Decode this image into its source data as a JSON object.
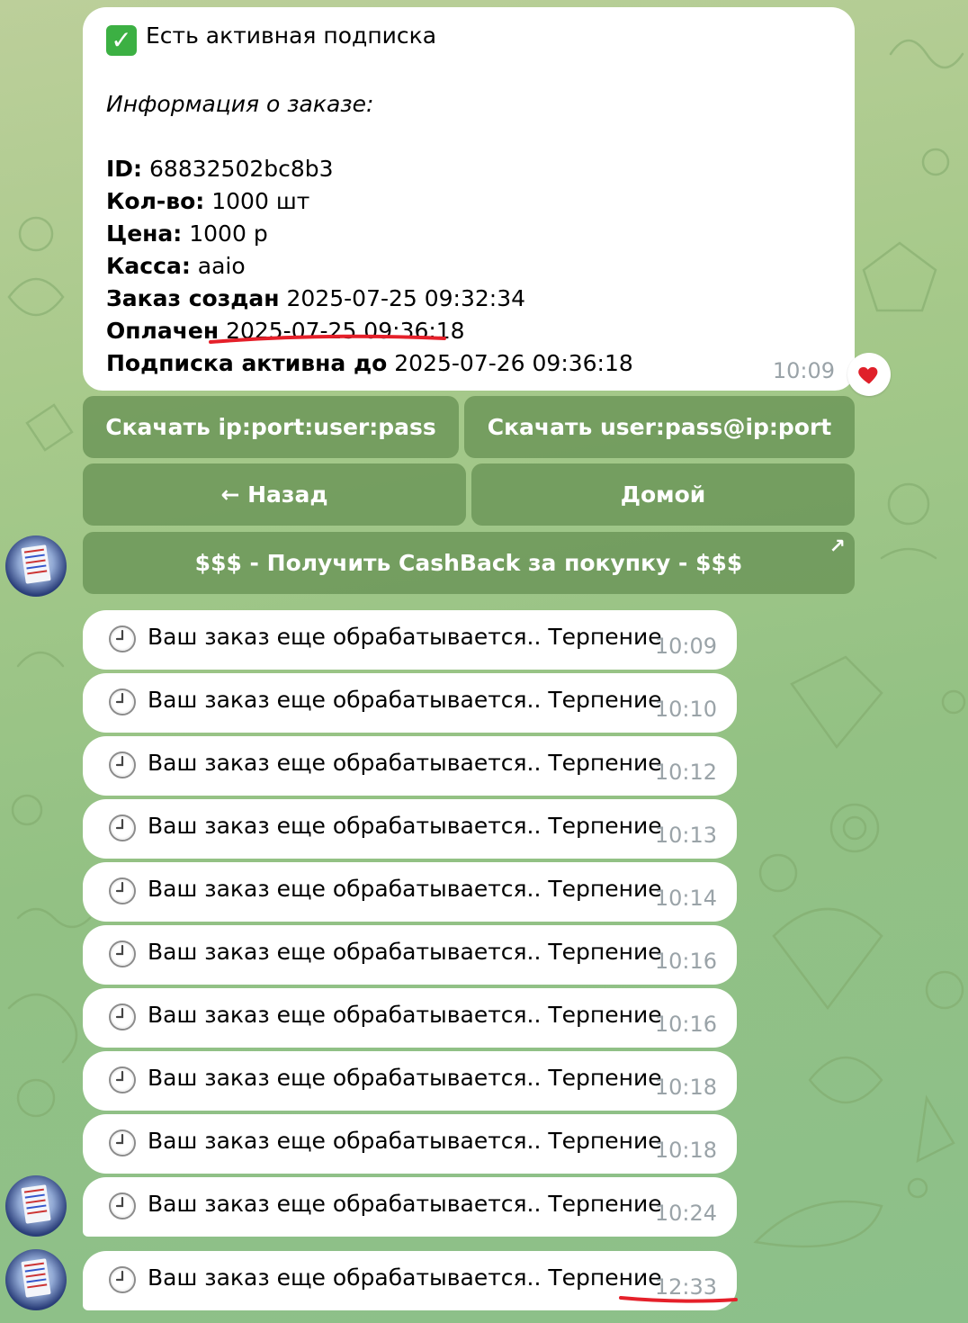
{
  "info_message": {
    "status_line": "Есть активная подписка",
    "subheading": "Информация о заказе:",
    "fields": [
      {
        "label": "ID:",
        "value": "68832502bc8b3"
      },
      {
        "label": "Кол-во:",
        "value": "1000 шт"
      },
      {
        "label": "Цена:",
        "value": "1000 р"
      },
      {
        "label": "Касса:",
        "value": "aaio"
      },
      {
        "label": "Заказ создан",
        "value": "2025-07-25 09:32:34"
      },
      {
        "label": "Оплачен",
        "value": "2025-07-25 09:36:18"
      },
      {
        "label": "Подписка активна до",
        "value": "2025-07-26 09:36:18"
      }
    ],
    "time": "10:09",
    "reaction_icon": "heart-icon"
  },
  "keyboard": {
    "download_ip_port": "Скачать ip:port:user:pass",
    "download_user_pass": "Скачать user:pass@ip:port",
    "back": "← Назад",
    "home": "Домой",
    "cashback": "$$$ - Получить CashBack за покупку - $$$"
  },
  "processing_messages": [
    {
      "text": "Ваш заказ еще обрабатывается.. Терпение",
      "time": "10:09"
    },
    {
      "text": "Ваш заказ еще обрабатывается.. Терпение",
      "time": "10:10"
    },
    {
      "text": "Ваш заказ еще обрабатывается.. Терпение",
      "time": "10:12"
    },
    {
      "text": "Ваш заказ еще обрабатывается.. Терпение",
      "time": "10:13"
    },
    {
      "text": "Ваш заказ еще обрабатывается.. Терпение",
      "time": "10:14"
    },
    {
      "text": "Ваш заказ еще обрабатывается.. Терпение",
      "time": "10:16"
    },
    {
      "text": "Ваш заказ еще обрабатывается.. Терпение",
      "time": "10:16"
    },
    {
      "text": "Ваш заказ еще обрабатывается.. Терпение",
      "time": "10:18"
    },
    {
      "text": "Ваш заказ еще обрабатывается.. Терпение",
      "time": "10:18"
    },
    {
      "text": "Ваш заказ еще обрабатывается.. Терпение",
      "time": "10:24"
    },
    {
      "text": "Ваш заказ еще обрабатывается.. Терпение",
      "time": "12:33"
    }
  ],
  "colors": {
    "background": "#9cc487",
    "bubble": "#ffffff",
    "keyboard_button": "#689254",
    "timestamp": "#9aa3a8",
    "annotation_red": "#e5202a",
    "check_green": "#3cb043"
  }
}
